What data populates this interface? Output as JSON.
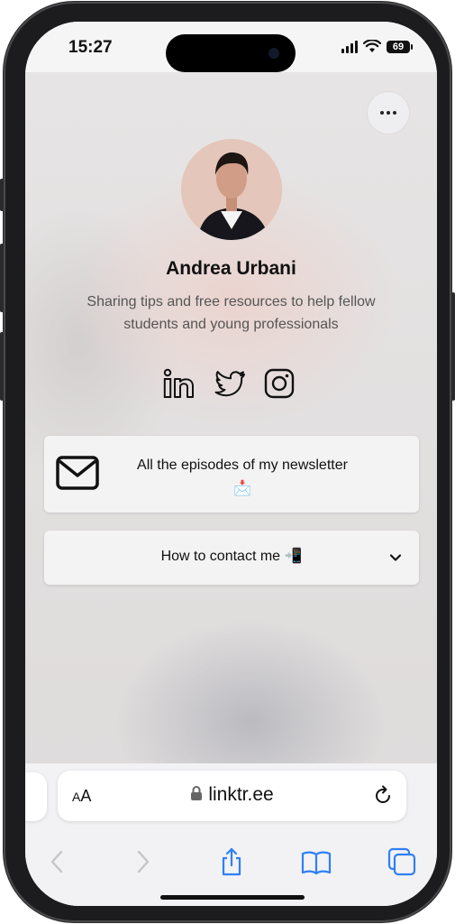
{
  "status_bar": {
    "time": "15:27",
    "battery": "69"
  },
  "profile": {
    "name": "Andrea Urbani",
    "bio": "Sharing tips and free resources to help fellow students and young professionals"
  },
  "socials": [
    {
      "icon": "linkedin-icon"
    },
    {
      "icon": "twitter-icon"
    },
    {
      "icon": "instagram-icon"
    }
  ],
  "links": [
    {
      "label": "All the episodes of my newsletter",
      "emoji": "📩",
      "icon": "mail-icon"
    },
    {
      "label": "How to contact me 📲",
      "icon": "chevron-down-icon"
    }
  ],
  "browser": {
    "text_size_label_small": "A",
    "text_size_label_large": "A",
    "url": "linktr.ee"
  },
  "colors": {
    "accent_blue": "#2f7ff5",
    "text": "#111111",
    "bio_text": "#555555"
  }
}
